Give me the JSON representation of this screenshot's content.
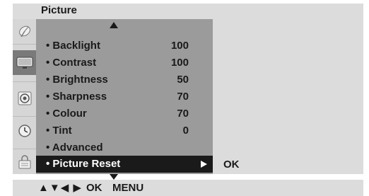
{
  "header": {
    "title": "Picture"
  },
  "menu": {
    "items": [
      {
        "label": "• Backlight",
        "value": "100"
      },
      {
        "label": "• Contrast",
        "value": "100"
      },
      {
        "label": "• Brightness",
        "value": "50"
      },
      {
        "label": "• Sharpness",
        "value": "70"
      },
      {
        "label": "• Colour",
        "value": "70"
      },
      {
        "label": "• Tint",
        "value": "0"
      },
      {
        "label": "• Advanced",
        "value": ""
      },
      {
        "label": "• Picture Reset",
        "value": ""
      }
    ],
    "selected_index": 7
  },
  "submenu": {
    "ok_label": "OK"
  },
  "sidebar": {
    "icons": [
      "satellite-dish-icon",
      "tv-screen-icon",
      "speaker-icon",
      "clock-icon",
      "lock-icon"
    ],
    "selected_index": 1
  },
  "footer": {
    "arrows": "▲▼◀ ▶",
    "ok": "OK",
    "menu": "MENU"
  },
  "colors": {
    "panel_bg": "#dcdcdc",
    "menu_bg": "#9b9b9b",
    "selected_bg": "#1a1a1a",
    "selected_text": "#ffffff"
  }
}
